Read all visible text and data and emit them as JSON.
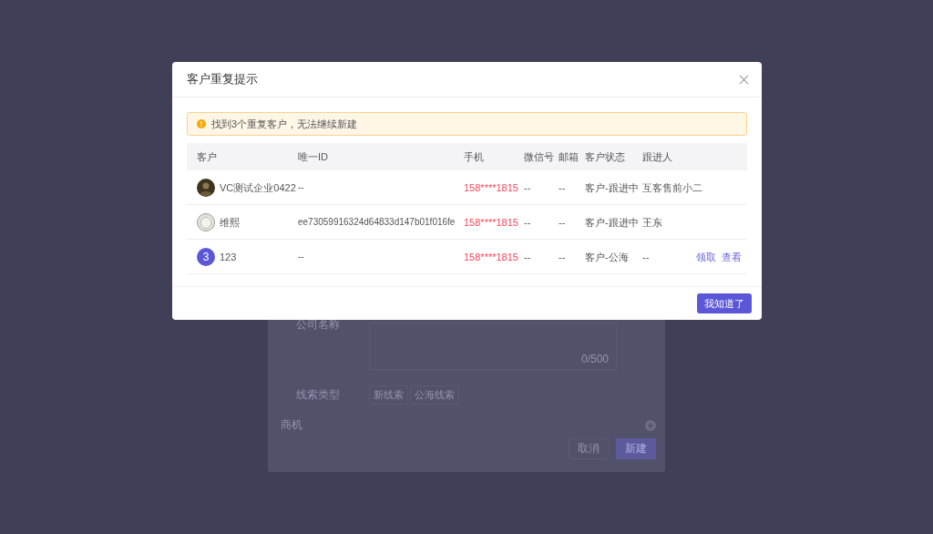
{
  "background_form": {
    "fields": [
      {
        "kind": "textarea",
        "label": "公司名称",
        "counter": "0/500"
      },
      {
        "kind": "tags",
        "label": "线索类型",
        "tags": [
          "新线索",
          "公海线索"
        ]
      }
    ],
    "section": "商机",
    "buttons": [
      {
        "label": "取消",
        "primary": false
      },
      {
        "label": "新建",
        "primary": true
      }
    ]
  },
  "dialog": {
    "title": "客户重复提示",
    "alert": "找到3个重复客户，无法继续新建",
    "columns": [
      "客户",
      "唯一ID",
      "手机",
      "微信号",
      "邮箱",
      "客户状态",
      "跟进人"
    ],
    "rows": [
      {
        "avatar": {
          "kind": "photo"
        },
        "name": "VC测试企业0422",
        "unique_id": "--",
        "phone": "158****1815",
        "wechat": "--",
        "email": "--",
        "status": "客户-跟进中",
        "owner": "互客售前小二",
        "actions": []
      },
      {
        "avatar": {
          "kind": "cartoon"
        },
        "name": "维熙",
        "unique_id": "ee73059916324d64833d147b01f016fe",
        "phone": "158****1815",
        "wechat": "--",
        "email": "--",
        "status": "客户-跟进中",
        "owner": "王东",
        "actions": []
      },
      {
        "avatar": {
          "kind": "letter",
          "text": "3"
        },
        "name": "123",
        "unique_id": "--",
        "phone": "158****1815",
        "wechat": "--",
        "email": "--",
        "status": "客户-公海",
        "owner": "--",
        "actions": [
          "领取",
          "查看"
        ]
      }
    ],
    "confirm": "我知道了"
  }
}
